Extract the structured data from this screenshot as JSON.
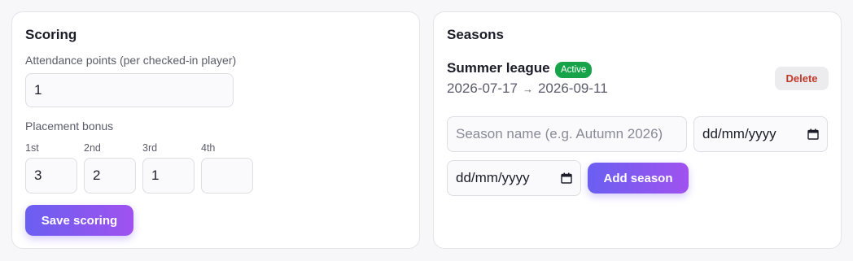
{
  "scoring": {
    "title": "Scoring",
    "attendance_label": "Attendance points (per checked-in player)",
    "attendance_value": "1",
    "placement_label": "Placement bonus",
    "places": [
      {
        "label": "1st",
        "value": "3"
      },
      {
        "label": "2nd",
        "value": "2"
      },
      {
        "label": "3rd",
        "value": "1"
      },
      {
        "label": "4th",
        "value": ""
      }
    ],
    "save_label": "Save scoring"
  },
  "seasons": {
    "title": "Seasons",
    "items": [
      {
        "name": "Summer league",
        "status": "Active",
        "start": "2026-07-17",
        "arrow": "→",
        "end": "2026-09-11",
        "delete_label": "Delete"
      }
    ],
    "form": {
      "name_placeholder": "Season name (e.g. Autumn 2026)",
      "start_date_placeholder": "dd/mm/yyyy",
      "end_date_placeholder": "dd/mm/yyyy",
      "add_label": "Add season"
    }
  },
  "colors": {
    "accent_start": "#6a5ff1",
    "accent_end": "#a052ef",
    "active_badge": "#17a34a",
    "delete_text": "#c0392b"
  },
  "icons": {
    "date_picker": "calendar-icon"
  }
}
